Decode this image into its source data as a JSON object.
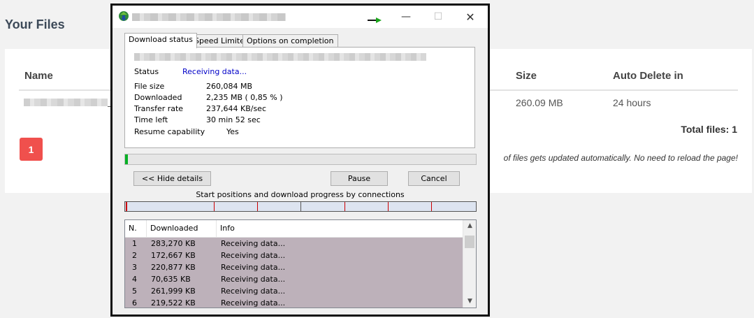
{
  "page": {
    "title": "Your Files",
    "columns": {
      "name": "Name",
      "size": "Size",
      "auto_delete": "Auto Delete in"
    },
    "file_row": {
      "size": "260.09 MB",
      "auto_delete": "24 hours"
    },
    "total_files": "Total files: 1",
    "pagination": {
      "current": "1"
    },
    "auto_update_note": "of files gets updated automatically. No need to reload the page!"
  },
  "dialog": {
    "window_controls": {
      "minimize": "—",
      "maximize": "☐",
      "close": "✕"
    },
    "tabs": [
      {
        "label": "Download status"
      },
      {
        "label": "Speed Limiter"
      },
      {
        "label": "Options on completion"
      }
    ],
    "status": {
      "label": "Status",
      "value": "Receiving data..."
    },
    "details": [
      {
        "label": "File size",
        "value": "260,084  MB"
      },
      {
        "label": "Downloaded",
        "value": "2,235  MB  ( 0,85 % )"
      },
      {
        "label": "Transfer rate",
        "value": "237,644  KB/sec"
      },
      {
        "label": "Time left",
        "value": "30 min 52 sec"
      }
    ],
    "resume": {
      "label": "Resume capability",
      "value": "Yes"
    },
    "progress_fraction": 0.0085,
    "buttons": {
      "hide_details": "<< Hide details",
      "pause": "Pause",
      "cancel": "Cancel"
    },
    "connections_title": "Start positions and download progress by connections",
    "list_headers": {
      "n": "N.",
      "downloaded": "Downloaded",
      "info": "Info"
    },
    "connections": [
      {
        "n": "1",
        "downloaded": "283,270  KB",
        "info": "Receiving data..."
      },
      {
        "n": "2",
        "downloaded": "172,667  KB",
        "info": "Receiving data..."
      },
      {
        "n": "3",
        "downloaded": "220,877  KB",
        "info": "Receiving data..."
      },
      {
        "n": "4",
        "downloaded": "70,635  KB",
        "info": "Receiving data..."
      },
      {
        "n": "5",
        "downloaded": "261,999  KB",
        "info": "Receiving data..."
      },
      {
        "n": "6",
        "downloaded": "219,522  KB",
        "info": "Receiving data..."
      }
    ],
    "colors": {
      "status_text": "#0000c8",
      "connection_marker": "#cc0000",
      "list_selection": "#bdb1ba"
    }
  }
}
